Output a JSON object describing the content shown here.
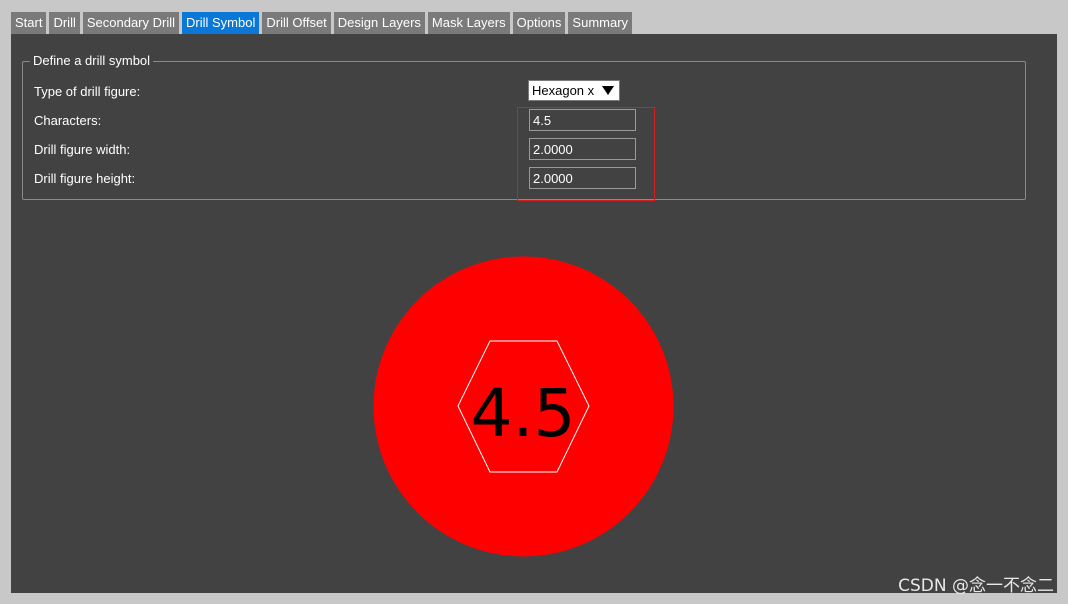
{
  "tabs": [
    {
      "label": "Start",
      "active": false
    },
    {
      "label": "Drill",
      "active": false
    },
    {
      "label": "Secondary Drill",
      "active": false
    },
    {
      "label": "Drill Symbol",
      "active": true
    },
    {
      "label": "Drill Offset",
      "active": false
    },
    {
      "label": "Design Layers",
      "active": false
    },
    {
      "label": "Mask Layers",
      "active": false
    },
    {
      "label": "Options",
      "active": false
    },
    {
      "label": "Summary",
      "active": false
    }
  ],
  "group": {
    "title": "Define a drill symbol",
    "type_label": "Type of drill figure:",
    "type_value": "Hexagon x",
    "characters_label": "Characters:",
    "characters_value": "4.5",
    "width_label": "Drill figure width:",
    "width_value": "2.0000",
    "height_label": "Drill figure height:",
    "height_value": "2.0000"
  },
  "preview": {
    "text": "4.5",
    "circle_color": "#ff0000",
    "hexagon_color": "#ffffff",
    "text_color": "#000000"
  },
  "watermark": "CSDN @念一不念二",
  "colors": {
    "active_tab": "#0a78d6",
    "inactive_tab": "#7a7a7a",
    "panel_bg": "#424242",
    "highlight": "#d02020"
  }
}
